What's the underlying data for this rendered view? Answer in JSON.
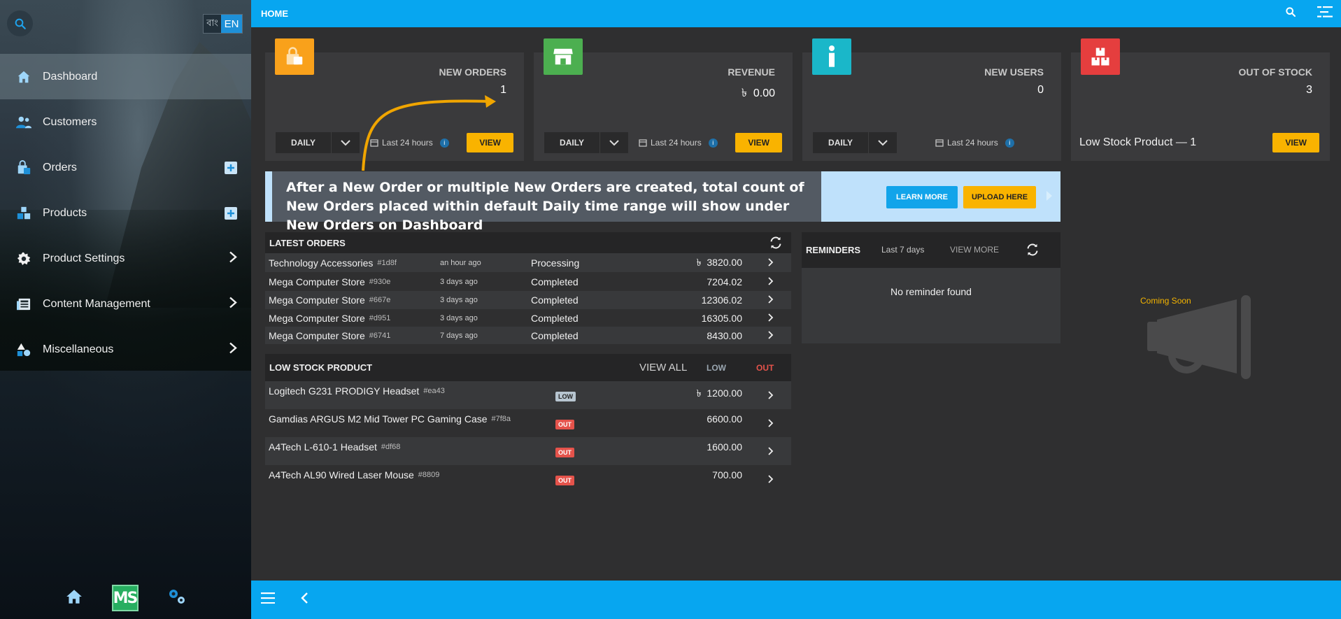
{
  "sidebar": {
    "lang_bn": "বাং",
    "lang_en": "EN",
    "items": [
      {
        "label": "Dashboard"
      },
      {
        "label": "Customers"
      },
      {
        "label": "Orders"
      },
      {
        "label": "Products"
      },
      {
        "label": "Product Settings"
      },
      {
        "label": "Content Management"
      },
      {
        "label": "Miscellaneous"
      }
    ],
    "footer_logo": "MS"
  },
  "topbar": {
    "title": "HOME"
  },
  "cards": [
    {
      "label": "NEW ORDERS",
      "value": "1",
      "range": "DAILY",
      "period": "Last 24 hours",
      "button": "VIEW",
      "color": "#f9a11b"
    },
    {
      "label": "REVENUE",
      "currency": "৳",
      "value": "0.00",
      "range": "DAILY",
      "period": "Last 24 hours",
      "button": "VIEW",
      "color": "#4caf50"
    },
    {
      "label": "NEW USERS",
      "value": "0",
      "range": "DAILY",
      "period": "Last 24 hours",
      "color": "#1ab7c9"
    },
    {
      "label": "OUT OF STOCK",
      "value": "3",
      "note": "Low Stock Product — 1",
      "button": "VIEW",
      "color": "#e53e3e"
    }
  ],
  "callout": {
    "text": "After a New Order or multiple New Orders are created, total count of New Orders placed within default Daily time range will show under New Orders on Dashboard",
    "learn_more": "LEARN MORE",
    "upload_here": "UPLOAD HERE"
  },
  "latest_orders": {
    "title": "LATEST ORDERS",
    "currency": "৳",
    "rows": [
      {
        "name": "Technology Accessories",
        "code": "#1d8f",
        "time": "an hour ago",
        "status": "Processing",
        "amount": "3820.00"
      },
      {
        "name": "Mega Computer Store",
        "code": "#930e",
        "time": "3 days ago",
        "status": "Completed",
        "amount": "7204.02"
      },
      {
        "name": "Mega Computer Store",
        "code": "#667e",
        "time": "3 days ago",
        "status": "Completed",
        "amount": "12306.02"
      },
      {
        "name": "Mega Computer Store",
        "code": "#d951",
        "time": "3 days ago",
        "status": "Completed",
        "amount": "16305.00"
      },
      {
        "name": "Mega Computer Store",
        "code": "#6741",
        "time": "7 days ago",
        "status": "Completed",
        "amount": "8430.00"
      }
    ]
  },
  "low_stock": {
    "title": "LOW STOCK PRODUCT",
    "view_all": "VIEW ALL",
    "filter_low": "LOW",
    "filter_out": "OUT",
    "currency": "৳",
    "rows": [
      {
        "name": "Logitech G231 PRODIGY Headset",
        "code": "#ea43",
        "tag": "LOW",
        "amount": "1200.00"
      },
      {
        "name": "Gamdias ARGUS M2 Mid Tower PC Gaming Case",
        "code": "#7f8a",
        "tag": "OUT",
        "amount": "6600.00"
      },
      {
        "name": "A4Tech L-610-1 Headset",
        "code": "#df68",
        "tag": "OUT",
        "amount": "1600.00"
      },
      {
        "name": "A4Tech AL90 Wired Laser Mouse",
        "code": "#8809",
        "tag": "OUT",
        "amount": "700.00"
      }
    ]
  },
  "reminders": {
    "title": "REMINDERS",
    "range": "Last 7 days",
    "view_more": "VIEW MORE",
    "empty": "No reminder found"
  },
  "coming_soon": "Coming Soon"
}
